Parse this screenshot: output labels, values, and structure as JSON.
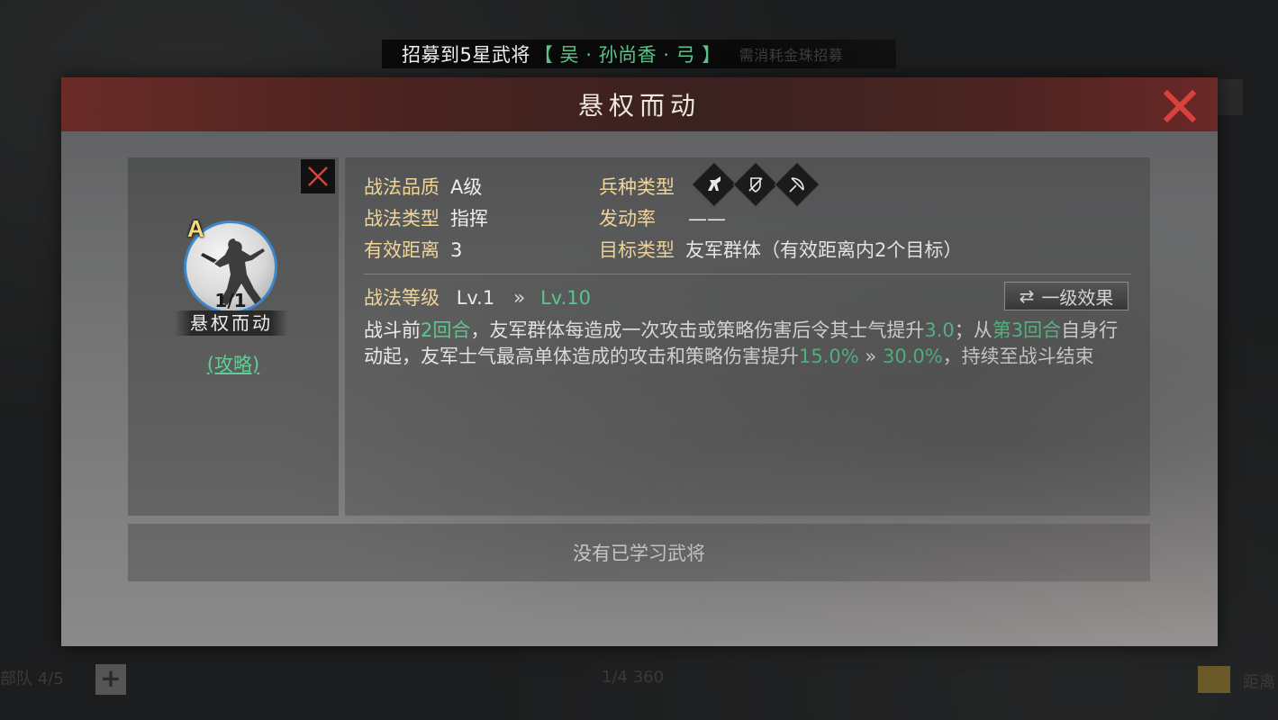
{
  "banner": {
    "prefix": "招募到5星武将",
    "hero": "【 吴 · 孙尚香 · 弓 】",
    "faded_text": "需消耗金珠招募"
  },
  "dialog": {
    "title": "悬权而动"
  },
  "skill_card": {
    "grade": "A",
    "count": "1/1",
    "name": "悬权而动",
    "guide_link": "(攻略)"
  },
  "stats": {
    "quality_label": "战法品质",
    "quality_value": "A级",
    "type_label": "战法类型",
    "type_value": "指挥",
    "range_label": "有效距离",
    "range_value": "3",
    "troop_label": "兵种类型",
    "troop_icons": [
      "horse-icon",
      "shield-icon",
      "bow-icon"
    ],
    "rate_label": "发动率",
    "rate_value": "——",
    "target_label": "目标类型",
    "target_value": "友军群体（有效距离内2个目标）"
  },
  "level": {
    "label": "战法等级",
    "from": "Lv.1",
    "to": "Lv.10",
    "effect_button": "一级效果"
  },
  "description": {
    "p1": "战斗前",
    "g1": "2回合",
    "p2": "，友军群体每造成一次攻击或策略伤害后令其士气提升",
    "g2": "3.0",
    "p3": "；从",
    "g3": "第3回合",
    "p4": "自身行动起，友军士气最高单体造成的攻击和策略伤害提升",
    "g4": "15.0%",
    "arrow": "»",
    "g5": "30.0%",
    "p5": "，持续至战斗结束"
  },
  "bottom": {
    "no_generals": "没有已学习武将"
  },
  "footer": {
    "left_text": "部队 4/5",
    "mid_text": "1/4 360",
    "right_text": "距离"
  },
  "colors": {
    "accent_green": "#5dcf94",
    "label_gold": "#f0d59a",
    "close_red": "#d8413c",
    "header_red": "#6a2b27"
  }
}
